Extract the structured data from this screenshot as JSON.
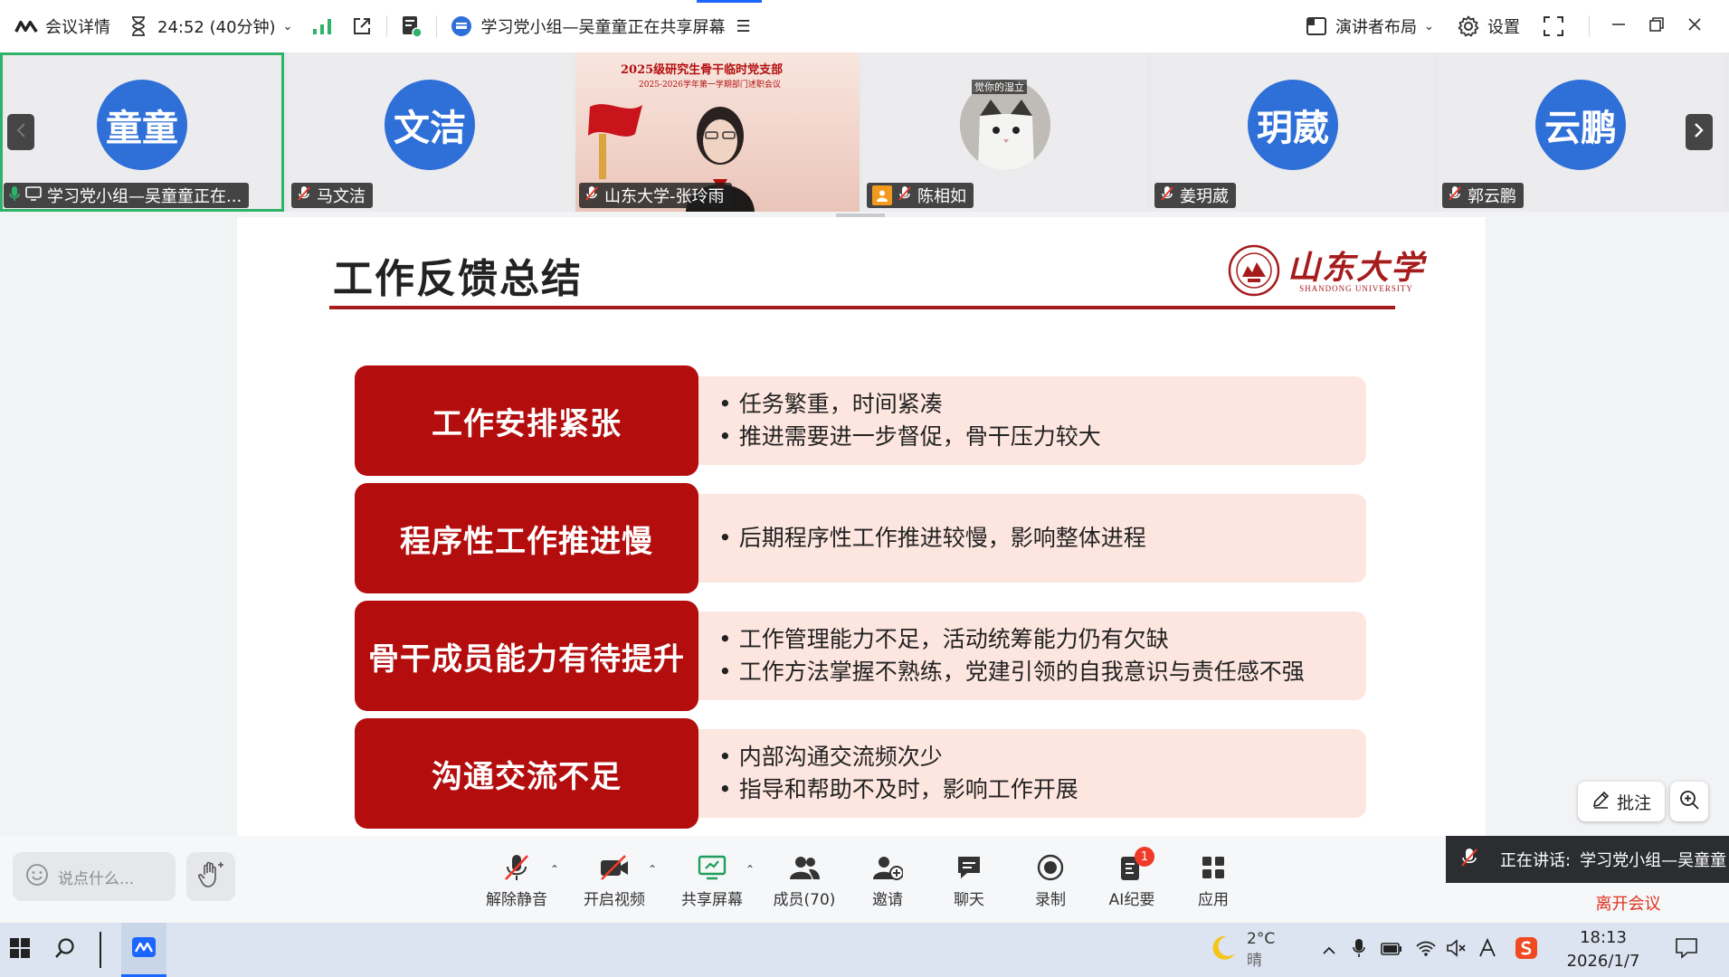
{
  "topbar": {
    "meeting_details": "会议详情",
    "timer": "24:52 (40分钟)",
    "share_title": "学习党小组—吴童童正在共享屏幕",
    "layout": "演讲者布局",
    "settings": "设置"
  },
  "participants": [
    {
      "avatar": "童童",
      "name": "学习党小组—吴童童正在..."
    },
    {
      "avatar": "文洁",
      "name": "马文洁"
    },
    {
      "avatar": "",
      "name": "山东大学-张玲雨",
      "video_title": "2025级研究生骨干临时党支部",
      "video_subtitle": "2025-2026学年第一学期部门述职会议"
    },
    {
      "avatar": "",
      "name": "陈相如",
      "video_caption": "觉你的湿立"
    },
    {
      "avatar": "玥葳",
      "name": "姜玥葳"
    },
    {
      "avatar": "云鹏",
      "name": "郭云鹏"
    }
  ],
  "slide": {
    "title": "工作反馈总结",
    "logo_main": "山东大学",
    "logo_sub": "SHANDONG UNIVERSITY",
    "rows": [
      {
        "label": "工作安排紧张",
        "points": [
          "任务繁重，时间紧凑",
          "推进需要进一步督促，骨干压力较大"
        ]
      },
      {
        "label": "程序性工作推进慢",
        "points": [
          "后期程序性工作推进较慢，影响整体进程"
        ]
      },
      {
        "label": "骨干成员能力有待提升",
        "points": [
          "工作管理能力不足，活动统筹能力仍有欠缺",
          "工作方法掌握不熟练，党建引领的自我意识与责任感不强"
        ]
      },
      {
        "label": "沟通交流不足",
        "points": [
          "内部沟通交流频次少",
          "指导和帮助不及时，影响工作开展"
        ]
      }
    ]
  },
  "floating": {
    "annotate": "批注",
    "speaking_label": "正在讲话:",
    "speaking_name": "学习党小组—吴童童",
    "leave": "离开会议"
  },
  "toolbar": {
    "chat_placeholder": "说点什么...",
    "tools": [
      {
        "label": "解除静音"
      },
      {
        "label": "开启视频"
      },
      {
        "label": "共享屏幕"
      },
      {
        "label": "成员(70)"
      },
      {
        "label": "邀请"
      },
      {
        "label": "聊天"
      },
      {
        "label": "录制"
      },
      {
        "label": "AI纪要",
        "badge": "1"
      },
      {
        "label": "应用"
      }
    ]
  },
  "taskbar": {
    "temperature": "2°C",
    "weather": "晴",
    "time": "18:13",
    "date": "2026/1/7"
  },
  "colors": {
    "accent": "#1a66ff",
    "slide_red": "#b30d0d",
    "slide_pink": "#fde6df",
    "avatar_blue": "#2f6fd8",
    "active_green": "#2db36a",
    "leave_red": "#e0301e"
  }
}
